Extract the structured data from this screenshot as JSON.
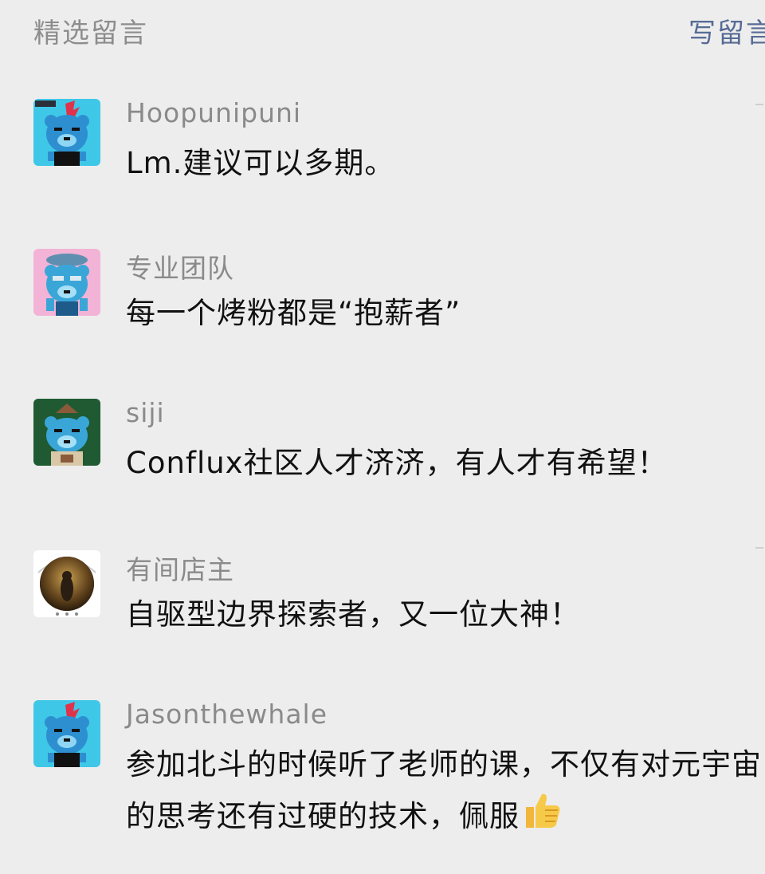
{
  "header": {
    "title": "精选留言",
    "write_label": "写留言"
  },
  "comments": [
    {
      "nickname": "Hoopunipuni",
      "content": "Lm.建议可以多期。",
      "avatar": "blue-bear-red-mohawk-avatar"
    },
    {
      "nickname": "专业团队",
      "content": "每一个烤粉都是“抱薪者”",
      "avatar": "blue-bear-pink-background-avatar"
    },
    {
      "nickname": "siji",
      "content": "Conflux社区人才济济，有人才有希望！",
      "avatar": "blue-bear-green-background-avatar"
    },
    {
      "nickname": "有间店主",
      "content": "自驱型边界探索者，又一位大神！",
      "avatar": "dark-circular-portrait-avatar"
    },
    {
      "nickname": "Jasonthewhale",
      "content": "参加北斗的时候听了老师的课，不仅有对元宇宙的思考还有过硬的技术，佩服",
      "avatar": "blue-bear-red-mohawk-avatar",
      "emoji": "thumbs-up-icon"
    }
  ],
  "colors": {
    "background": "#ededed",
    "link": "#576b95",
    "muted": "#8a8a8a",
    "text": "#111111"
  }
}
